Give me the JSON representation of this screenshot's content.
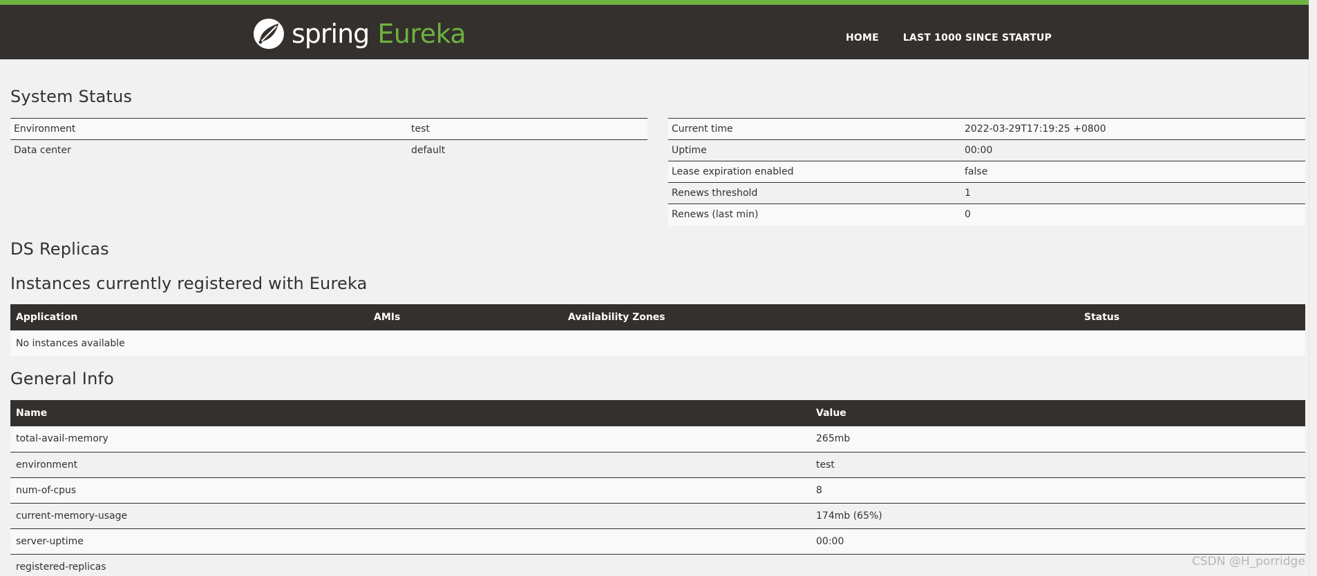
{
  "header": {
    "brand_spring": "spring",
    "brand_eureka": "Eureka",
    "nav": [
      "HOME",
      "LAST 1000 SINCE STARTUP"
    ]
  },
  "system_status": {
    "title": "System Status",
    "left": [
      {
        "label": "Environment",
        "value": "test"
      },
      {
        "label": "Data center",
        "value": "default"
      }
    ],
    "right": [
      {
        "label": "Current time",
        "value": "2022-03-29T17:19:25 +0800"
      },
      {
        "label": "Uptime",
        "value": "00:00"
      },
      {
        "label": "Lease expiration enabled",
        "value": "false"
      },
      {
        "label": "Renews threshold",
        "value": "1"
      },
      {
        "label": "Renews (last min)",
        "value": "0"
      }
    ]
  },
  "ds_replicas": {
    "title": "DS Replicas"
  },
  "instances": {
    "title": "Instances currently registered with Eureka",
    "columns": [
      "Application",
      "AMIs",
      "Availability Zones",
      "Status"
    ],
    "empty_text": "No instances available"
  },
  "general_info": {
    "title": "General Info",
    "columns": [
      "Name",
      "Value"
    ],
    "rows": [
      {
        "name": "total-avail-memory",
        "value": "265mb"
      },
      {
        "name": "environment",
        "value": "test"
      },
      {
        "name": "num-of-cpus",
        "value": "8"
      },
      {
        "name": "current-memory-usage",
        "value": "174mb (65%)"
      },
      {
        "name": "server-uptime",
        "value": "00:00"
      },
      {
        "name": "registered-replicas",
        "value": ""
      }
    ]
  },
  "watermark": "CSDN @H_porridge",
  "colors": {
    "brand_green": "#6db33f",
    "header_bg": "#34302d",
    "page_bg": "#f1f1f1"
  }
}
